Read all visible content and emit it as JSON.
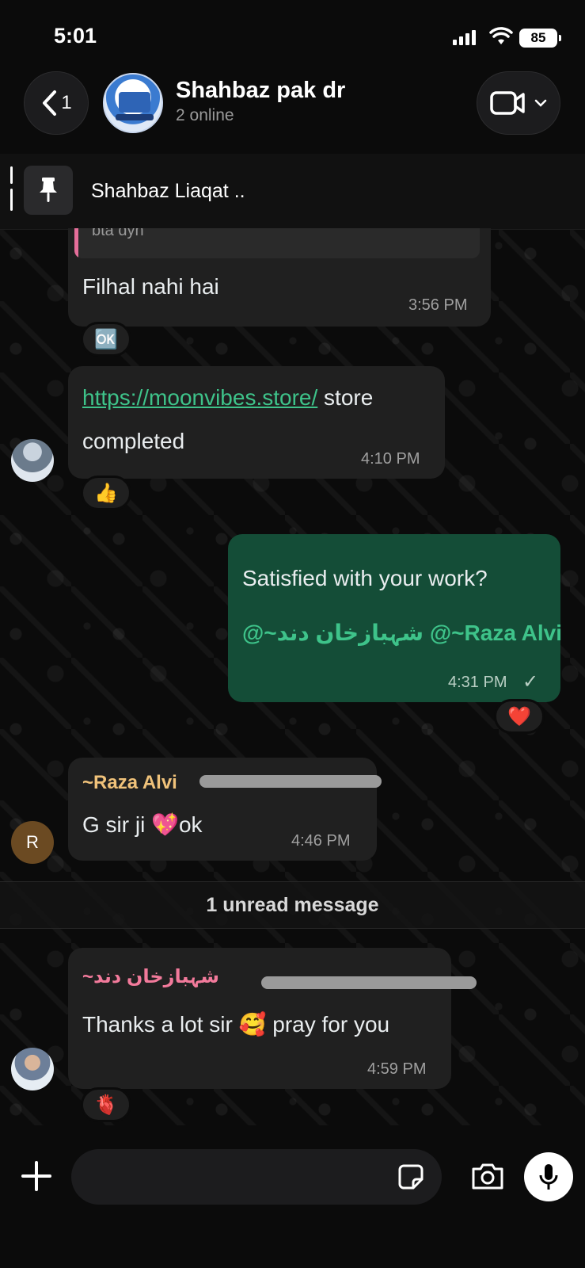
{
  "status_bar": {
    "time": "5:01",
    "battery": "85"
  },
  "header": {
    "back_count": "1",
    "title": "Shahbaz pak dr",
    "subtitle": "2 online"
  },
  "pinned": {
    "text": "Shahbaz Liaqat .."
  },
  "messages": [
    {
      "direction": "in",
      "quote_text": "bta dyn",
      "text": "Filhal nahi hai",
      "time": "3:56 PM",
      "reaction": "🆗"
    },
    {
      "direction": "in",
      "link": "https://moonvibes.store/",
      "text_after_link": " store",
      "text_line2": "completed",
      "time": "4:10 PM",
      "reaction": "👍"
    },
    {
      "direction": "out",
      "text": "Satisfied with your work?",
      "mention_1": "@~شہبازخان دند",
      "mention_2": "@~Raza Alvi",
      "time": "4:31 PM",
      "status": "✓",
      "reaction": "❤️"
    },
    {
      "direction": "in",
      "sender": "~Raza Alvi",
      "text": "G sir ji 💖ok",
      "time": "4:46 PM",
      "avatar_initial": "R"
    },
    {
      "direction": "in",
      "sender": "~شہبازخان دند",
      "text": "Thanks a lot sir 🥰 pray for you",
      "time": "4:59 PM",
      "reaction": "🫀"
    }
  ],
  "unread_divider": "1 unread message",
  "input": {
    "placeholder": ""
  },
  "colors": {
    "outgoing_bubble": "#144d37",
    "incoming_bubble": "#202020",
    "sender_raza": "#f0c27a",
    "sender_shahbaz": "#f27a9b"
  },
  "icons": [
    "back-chevron-icon",
    "video-call-icon",
    "pin-icon",
    "plus-icon",
    "sticker-icon",
    "camera-icon",
    "mic-icon"
  ]
}
